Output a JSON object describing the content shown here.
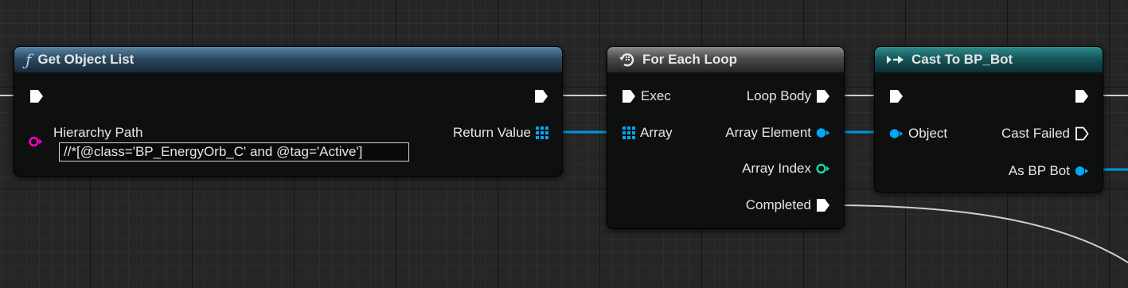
{
  "colors": {
    "exec": "#ffffff",
    "object_pin": "#00a8f4",
    "string_pin": "#ff00d4",
    "integer_pin": "#1ed6a6",
    "wire_exec": "#d0d0d0",
    "wire_object": "#0098e0"
  },
  "nodes": {
    "get_object_list": {
      "icon": "function-icon",
      "title": "Get Object List",
      "hierarchy_path_label": "Hierarchy Path",
      "hierarchy_path_value": "//*[@class='BP_EnergyOrb_C' and @tag='Active']",
      "return_value_label": "Return Value"
    },
    "for_each_loop": {
      "icon": "loop-icon",
      "title": "For Each Loop",
      "exec_label": "Exec",
      "loop_body_label": "Loop Body",
      "array_label": "Array",
      "array_element_label": "Array Element",
      "array_index_label": "Array Index",
      "completed_label": "Completed"
    },
    "cast_to_bp_bot": {
      "icon": "cast-icon",
      "title": "Cast To BP_Bot",
      "object_label": "Object",
      "cast_failed_label": "Cast Failed",
      "as_bp_bot_label": "As BP Bot"
    }
  }
}
